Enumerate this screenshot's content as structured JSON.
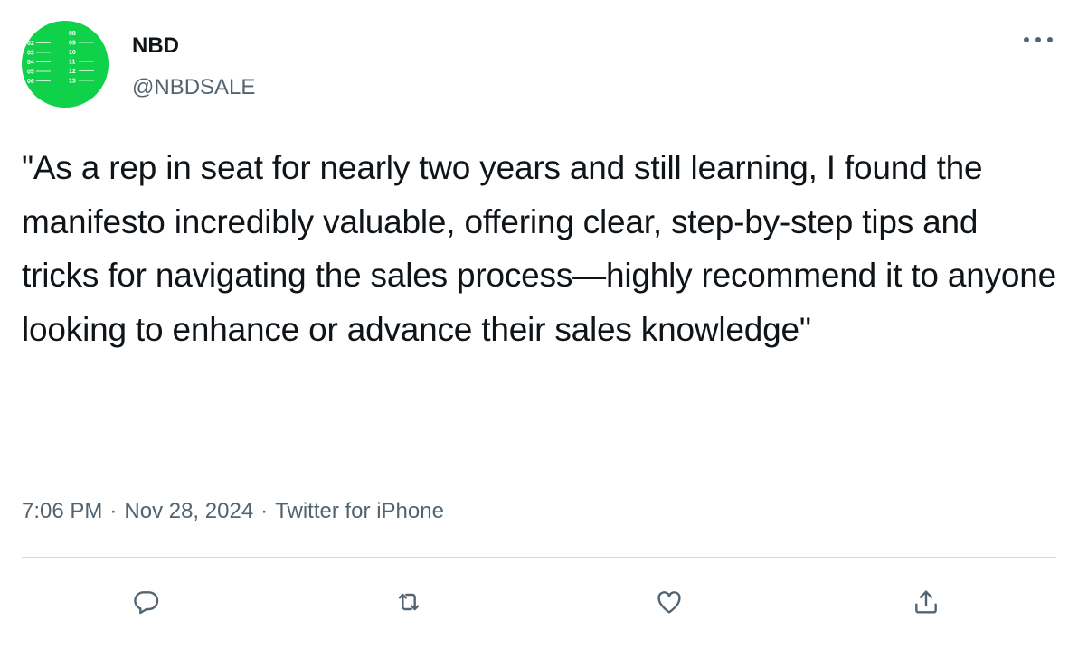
{
  "tweet": {
    "author_name": "NBD",
    "author_handle": "@NBDSALE",
    "text": "\"As a rep in seat for nearly two years and still learning, I found the manifesto incredibly valuable, offering clear, step-by-step tips and tricks for navigating the sales process—highly recommend it to anyone looking to enhance or advance their sales knowledge\"",
    "time": "7:06 PM",
    "date": "Nov 28, 2024",
    "source": "Twitter for iPhone",
    "separator": "·"
  },
  "avatar": {
    "background": "#0fd24a",
    "numbers_left": [
      "02",
      "03",
      "04",
      "05",
      "06"
    ],
    "numbers_right": [
      "08",
      "09",
      "10",
      "11",
      "12",
      "13"
    ]
  },
  "icons": {
    "more": "more-options-icon",
    "reply": "reply-icon",
    "retweet": "retweet-icon",
    "like": "like-icon",
    "share": "share-icon"
  },
  "colors": {
    "text_primary": "#0f1419",
    "text_secondary": "#536471",
    "divider": "#cfd9de",
    "icon": "#536471"
  }
}
